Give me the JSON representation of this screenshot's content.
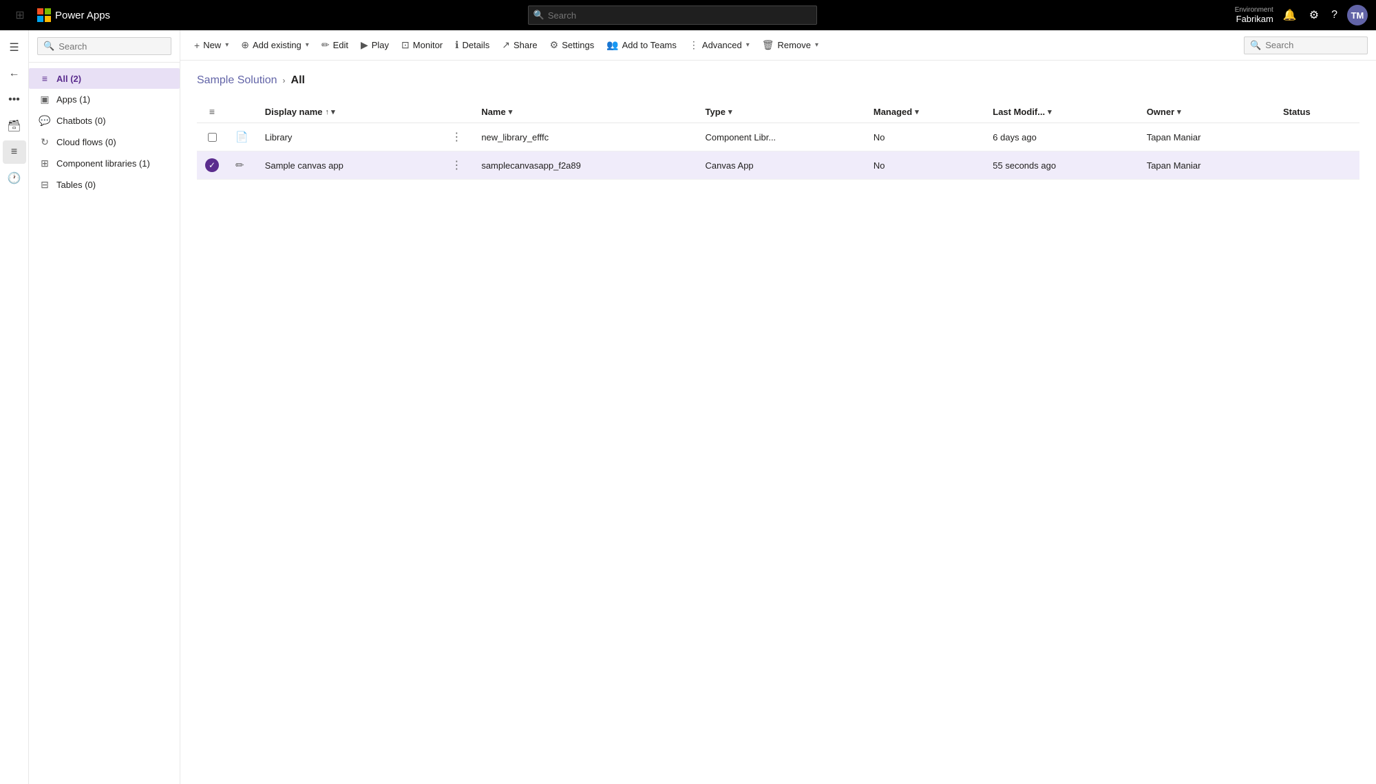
{
  "topNav": {
    "appName": "Power Apps",
    "searchPlaceholder": "Search",
    "environment": {
      "label": "Environment",
      "name": "Fabrikam"
    },
    "avatarInitials": "TM"
  },
  "sidebar": {
    "searchPlaceholder": "Search",
    "items": [
      {
        "id": "all",
        "label": "All  (2)",
        "icon": "≡",
        "active": true
      },
      {
        "id": "apps",
        "label": "Apps  (1)",
        "icon": "▣",
        "active": false
      },
      {
        "id": "chatbots",
        "label": "Chatbots  (0)",
        "icon": "◫",
        "active": false
      },
      {
        "id": "cloud-flows",
        "label": "Cloud flows  (0)",
        "icon": "↻",
        "active": false
      },
      {
        "id": "component-libraries",
        "label": "Component libraries  (1)",
        "icon": "⊞",
        "active": false
      },
      {
        "id": "tables",
        "label": "Tables  (0)",
        "icon": "⊟",
        "active": false
      }
    ]
  },
  "toolbar": {
    "new": "New",
    "addExisting": "Add existing",
    "edit": "Edit",
    "play": "Play",
    "monitor": "Monitor",
    "details": "Details",
    "share": "Share",
    "settings": "Settings",
    "addToTeams": "Add to Teams",
    "advanced": "Advanced",
    "remove": "Remove",
    "searchPlaceholder": "Search"
  },
  "breadcrumb": {
    "parent": "Sample Solution",
    "current": "All"
  },
  "table": {
    "columns": [
      {
        "id": "display-name",
        "label": "Display name",
        "sortable": true,
        "sorted": "asc"
      },
      {
        "id": "name",
        "label": "Name",
        "sortable": true
      },
      {
        "id": "type",
        "label": "Type",
        "sortable": true
      },
      {
        "id": "managed",
        "label": "Managed",
        "sortable": true
      },
      {
        "id": "last-modified",
        "label": "Last Modif...",
        "sortable": true
      },
      {
        "id": "owner",
        "label": "Owner",
        "sortable": true
      },
      {
        "id": "status",
        "label": "Status",
        "sortable": false
      }
    ],
    "rows": [
      {
        "id": "1",
        "displayName": "Library",
        "name": "new_library_efffc",
        "type": "Component Libr...",
        "managed": "No",
        "lastModified": "6 days ago",
        "owner": "Tapan Maniar",
        "status": "",
        "selected": false,
        "icon": "pages"
      },
      {
        "id": "2",
        "displayName": "Sample canvas app",
        "name": "samplecanvasapp_f2a89",
        "type": "Canvas App",
        "managed": "No",
        "lastModified": "55 seconds ago",
        "owner": "Tapan Maniar",
        "status": "",
        "selected": true,
        "icon": "pencil"
      }
    ]
  }
}
